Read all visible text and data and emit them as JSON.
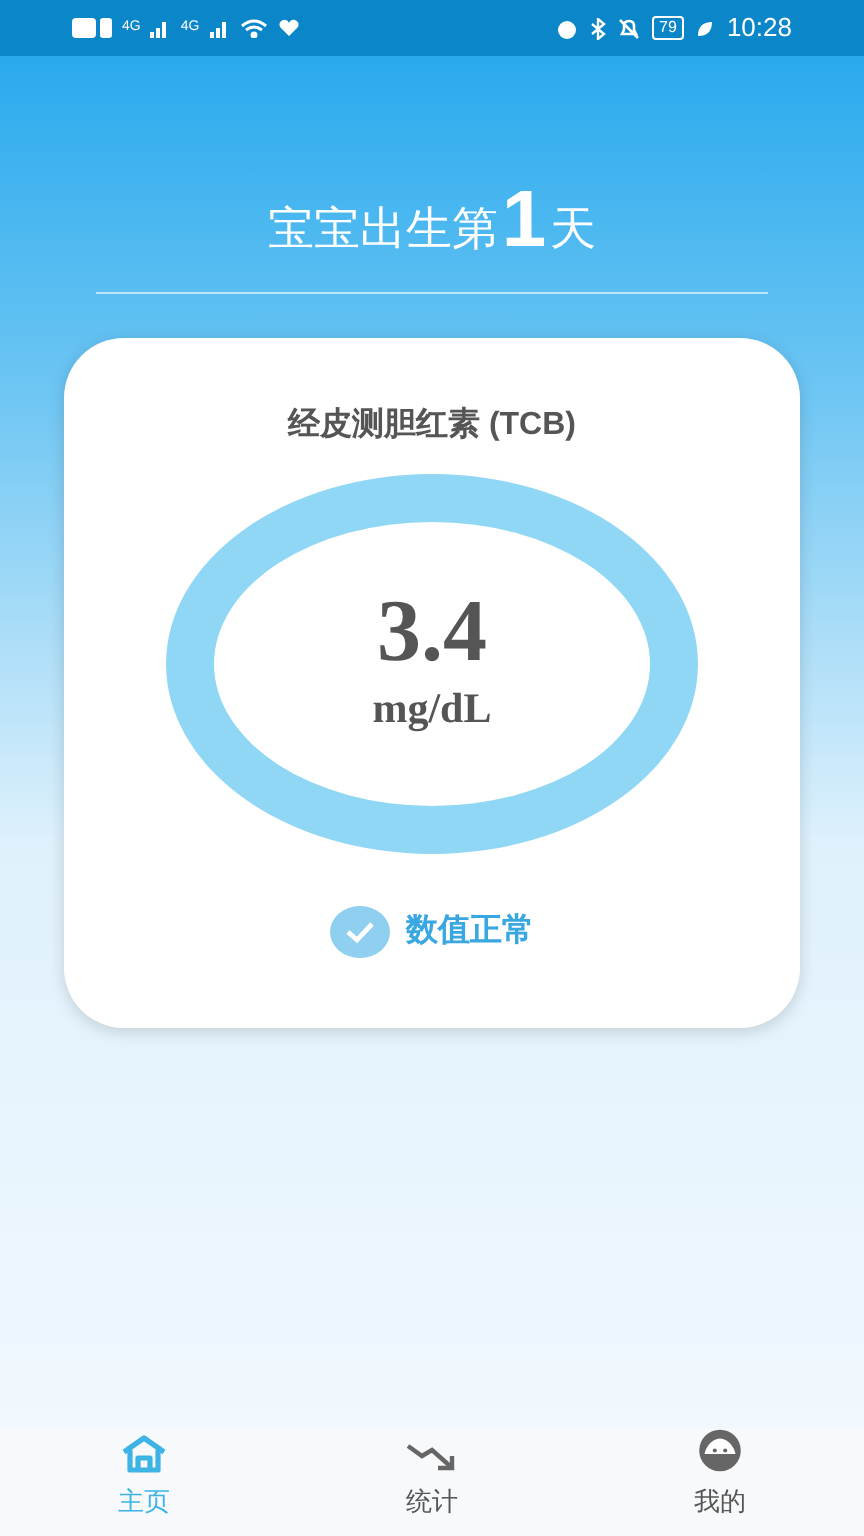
{
  "status_bar": {
    "network_1": "4G",
    "network_2": "4G",
    "battery": "79",
    "time": "10:28"
  },
  "header": {
    "prefix": "宝宝出生第",
    "day": "1",
    "suffix": "天"
  },
  "card": {
    "title": "经皮测胆红素 (TCB)",
    "value": "3.4",
    "unit": "mg/dL",
    "status": {
      "text": "数值正常",
      "normal": true
    }
  },
  "nav": [
    {
      "kind": "home",
      "label": "主页",
      "selected": true
    },
    {
      "kind": "stats",
      "label": "统计",
      "selected": false
    },
    {
      "kind": "me",
      "label": "我的",
      "selected": false
    }
  ]
}
